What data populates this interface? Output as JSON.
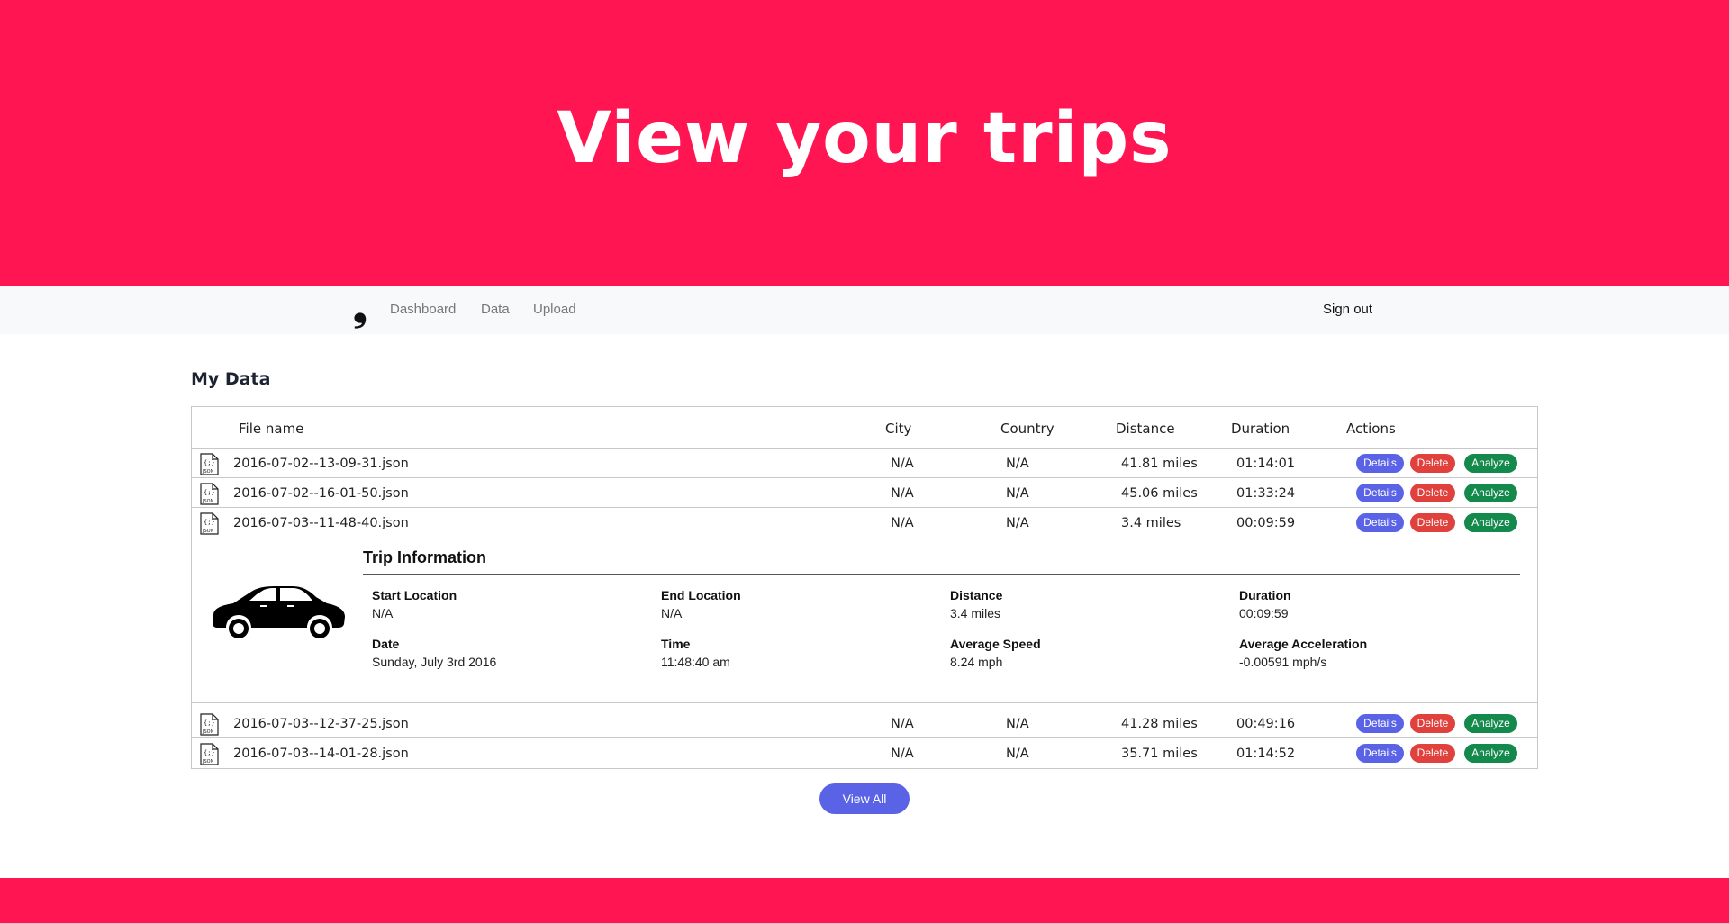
{
  "hero": {
    "title": "View your trips"
  },
  "nav": {
    "brand": "❟",
    "links": [
      "Dashboard",
      "Data",
      "Upload"
    ],
    "signout": "Sign out"
  },
  "section": {
    "title": "My Data"
  },
  "table": {
    "headers": [
      "File name",
      "City",
      "Country",
      "Distance",
      "Duration",
      "Actions"
    ],
    "rows": [
      {
        "file": "2016-07-02--13-09-31.json",
        "city": "N/A",
        "country": "N/A",
        "distance": "41.81 miles",
        "duration": "01:14:01"
      },
      {
        "file": "2016-07-02--16-01-50.json",
        "city": "N/A",
        "country": "N/A",
        "distance": "45.06 miles",
        "duration": "01:33:24"
      },
      {
        "file": "2016-07-03--11-48-40.json",
        "city": "N/A",
        "country": "N/A",
        "distance": "3.4 miles",
        "duration": "00:09:59"
      },
      {
        "file": "2016-07-03--12-37-25.json",
        "city": "N/A",
        "country": "N/A",
        "distance": "41.28 miles",
        "duration": "00:49:16"
      },
      {
        "file": "2016-07-03--14-01-28.json",
        "city": "N/A",
        "country": "N/A",
        "distance": "35.71 miles",
        "duration": "01:14:52"
      }
    ],
    "actions": {
      "details": "Details",
      "delete": "Delete",
      "analyze": "Analyze"
    }
  },
  "trip_info": {
    "title": "Trip Information",
    "start_location": {
      "label": "Start Location",
      "value": "N/A"
    },
    "end_location": {
      "label": "End Location",
      "value": "N/A"
    },
    "distance": {
      "label": "Distance",
      "value": "3.4 miles"
    },
    "duration": {
      "label": "Duration",
      "value": "00:09:59"
    },
    "date": {
      "label": "Date",
      "value": "Sunday, July 3rd 2016"
    },
    "time": {
      "label": "Time",
      "value": "11:48:40 am"
    },
    "avg_speed": {
      "label": "Average Speed",
      "value": "8.24 mph"
    },
    "avg_accel": {
      "label": "Average Acceleration",
      "value": "-0.00591 mph/s"
    }
  },
  "view_all": "View All",
  "colors": {
    "brand": "#ff1551",
    "details": "#5a63e6",
    "delete": "#e0413d",
    "analyze": "#13894c"
  },
  "icons": {
    "file": "json-file-icon",
    "car": "car-icon"
  }
}
